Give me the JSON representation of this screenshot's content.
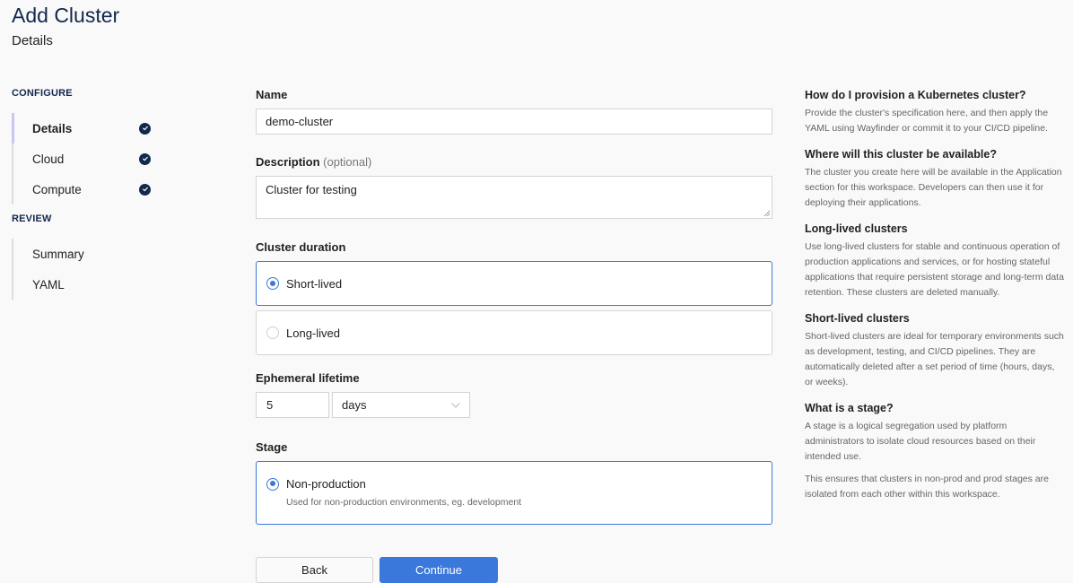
{
  "header": {
    "title": "Add Cluster",
    "subtitle": "Details"
  },
  "sidebar": {
    "sections": [
      {
        "label": "CONFIGURE",
        "items": [
          {
            "label": "Details",
            "active": true,
            "completed": true
          },
          {
            "label": "Cloud",
            "active": false,
            "completed": true
          },
          {
            "label": "Compute",
            "active": false,
            "completed": true
          }
        ]
      },
      {
        "label": "REVIEW",
        "items": [
          {
            "label": "Summary",
            "active": false,
            "completed": false
          },
          {
            "label": "YAML",
            "active": false,
            "completed": false
          }
        ]
      }
    ]
  },
  "form": {
    "name": {
      "label": "Name",
      "value": "demo-cluster"
    },
    "description": {
      "label": "Description",
      "optional_hint": "(optional)",
      "value": "Cluster for testing"
    },
    "cluster_duration": {
      "label": "Cluster duration",
      "options": [
        {
          "label": "Short-lived",
          "selected": true
        },
        {
          "label": "Long-lived",
          "selected": false
        }
      ]
    },
    "ephemeral_lifetime": {
      "label": "Ephemeral lifetime",
      "value": "5",
      "unit": "days"
    },
    "stage": {
      "label": "Stage",
      "options": [
        {
          "label": "Non-production",
          "description": "Used for non-production environments, eg. development",
          "selected": true
        }
      ]
    },
    "buttons": {
      "back": "Back",
      "continue": "Continue"
    }
  },
  "help": [
    {
      "title": "How do I provision a Kubernetes cluster?",
      "paragraphs": [
        "Provide the cluster's specification here, and then apply the YAML using Wayfinder or commit it to your CI/CD pipeline."
      ]
    },
    {
      "title": "Where will this cluster be available?",
      "paragraphs": [
        "The cluster you create here will be available in the Application section for this workspace. Developers can then use it for deploying their applications."
      ]
    },
    {
      "title": "Long-lived clusters",
      "paragraphs": [
        "Use long-lived clusters for stable and continuous operation of production applications and services, or for hosting stateful applications that require persistent storage and long-term data retention. These clusters are deleted manually."
      ]
    },
    {
      "title": "Short-lived clusters",
      "paragraphs": [
        "Short-lived clusters are ideal for temporary environments such as development, testing, and CI/CD pipelines. They are automatically deleted after a set period of time (hours, days, or weeks)."
      ]
    },
    {
      "title": "What is a stage?",
      "paragraphs": [
        "A stage is a logical segregation used by platform administrators to isolate cloud resources based on their intended use.",
        "This ensures that clusters in non-prod and prod stages are isolated from each other within this workspace."
      ]
    }
  ],
  "colors": {
    "brand_navy": "#12284c",
    "accent_blue": "#3b78dc",
    "active_indicator": "#c8c6f2"
  }
}
